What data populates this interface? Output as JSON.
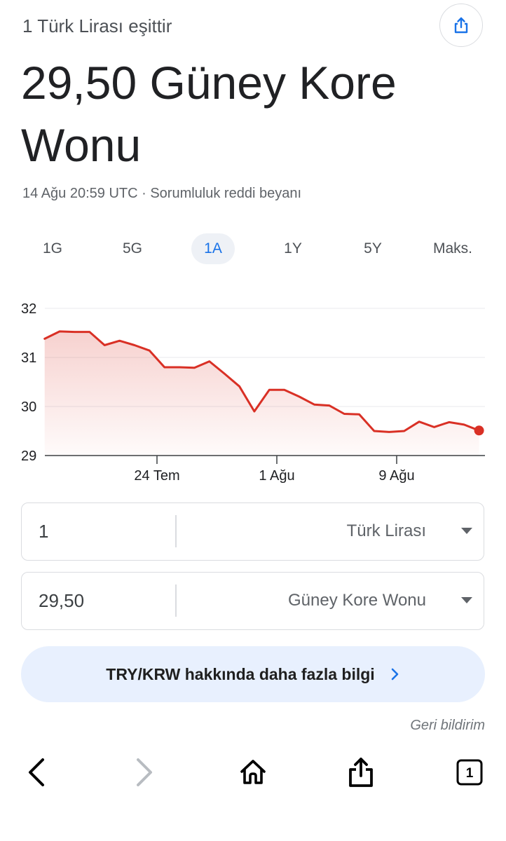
{
  "header": {
    "subtitle": "1 Türk Lirası eşittir",
    "headline": "29,50 Güney Kore Wonu",
    "meta": "14 Ağu 20:59 UTC · Sorumluluk reddi beyanı",
    "share_icon": "share-icon"
  },
  "ranges": [
    {
      "label": "1G",
      "active": false
    },
    {
      "label": "5G",
      "active": false
    },
    {
      "label": "1A",
      "active": true
    },
    {
      "label": "1Y",
      "active": false
    },
    {
      "label": "5Y",
      "active": false
    },
    {
      "label": "Maks.",
      "active": false
    }
  ],
  "chart_data": {
    "type": "area",
    "ylim": [
      29,
      32
    ],
    "y_ticks": [
      "32",
      "31",
      "30",
      "29"
    ],
    "y_tick_values": [
      32,
      31,
      30,
      29
    ],
    "x_tick_labels": [
      "24 Tem",
      "1 Ağu",
      "9 Ağu"
    ],
    "x_tick_days": [
      24,
      32,
      40
    ],
    "grid": true,
    "line_color": "#d93025",
    "series": [
      {
        "x": [
          16.5,
          17.5,
          18.5,
          19.5,
          20.5,
          21.5,
          22.5,
          23.5,
          24.5,
          25.5,
          26.5,
          27.5,
          28.5,
          29.5,
          30.5,
          31.5,
          32.5,
          33.5,
          34.5,
          35.5,
          36.5,
          37.5,
          38.5,
          39.5,
          40.5,
          41.5,
          42.5,
          43.5,
          44.5,
          45.5
        ],
        "y": [
          31.38,
          31.53,
          31.52,
          31.52,
          31.25,
          31.34,
          31.25,
          31.14,
          30.8,
          30.8,
          30.79,
          30.92,
          30.67,
          30.41,
          29.9,
          30.34,
          30.34,
          30.2,
          30.04,
          30.02,
          29.85,
          29.84,
          29.5,
          29.48,
          29.5,
          29.69,
          29.58,
          29.68,
          29.63,
          29.51
        ]
      }
    ]
  },
  "converter": {
    "from": {
      "value": "1",
      "currency": "Türk Lirası"
    },
    "to": {
      "value": "29,50",
      "currency": "Güney Kore Wonu"
    }
  },
  "more": {
    "label": "TRY/KRW hakkında daha fazla bilgi",
    "icon": "chevron-right-icon"
  },
  "feedback": "Geri bildirim",
  "toolbar": {
    "back_icon": "back-arrow-icon",
    "forward_icon": "forward-arrow-icon",
    "home_icon": "home-icon",
    "share_icon": "share-icon",
    "tabs_count": "1"
  },
  "colors": {
    "accent": "#1a73e8",
    "chart_line": "#d93025",
    "more_bg": "#e8f0fe"
  }
}
